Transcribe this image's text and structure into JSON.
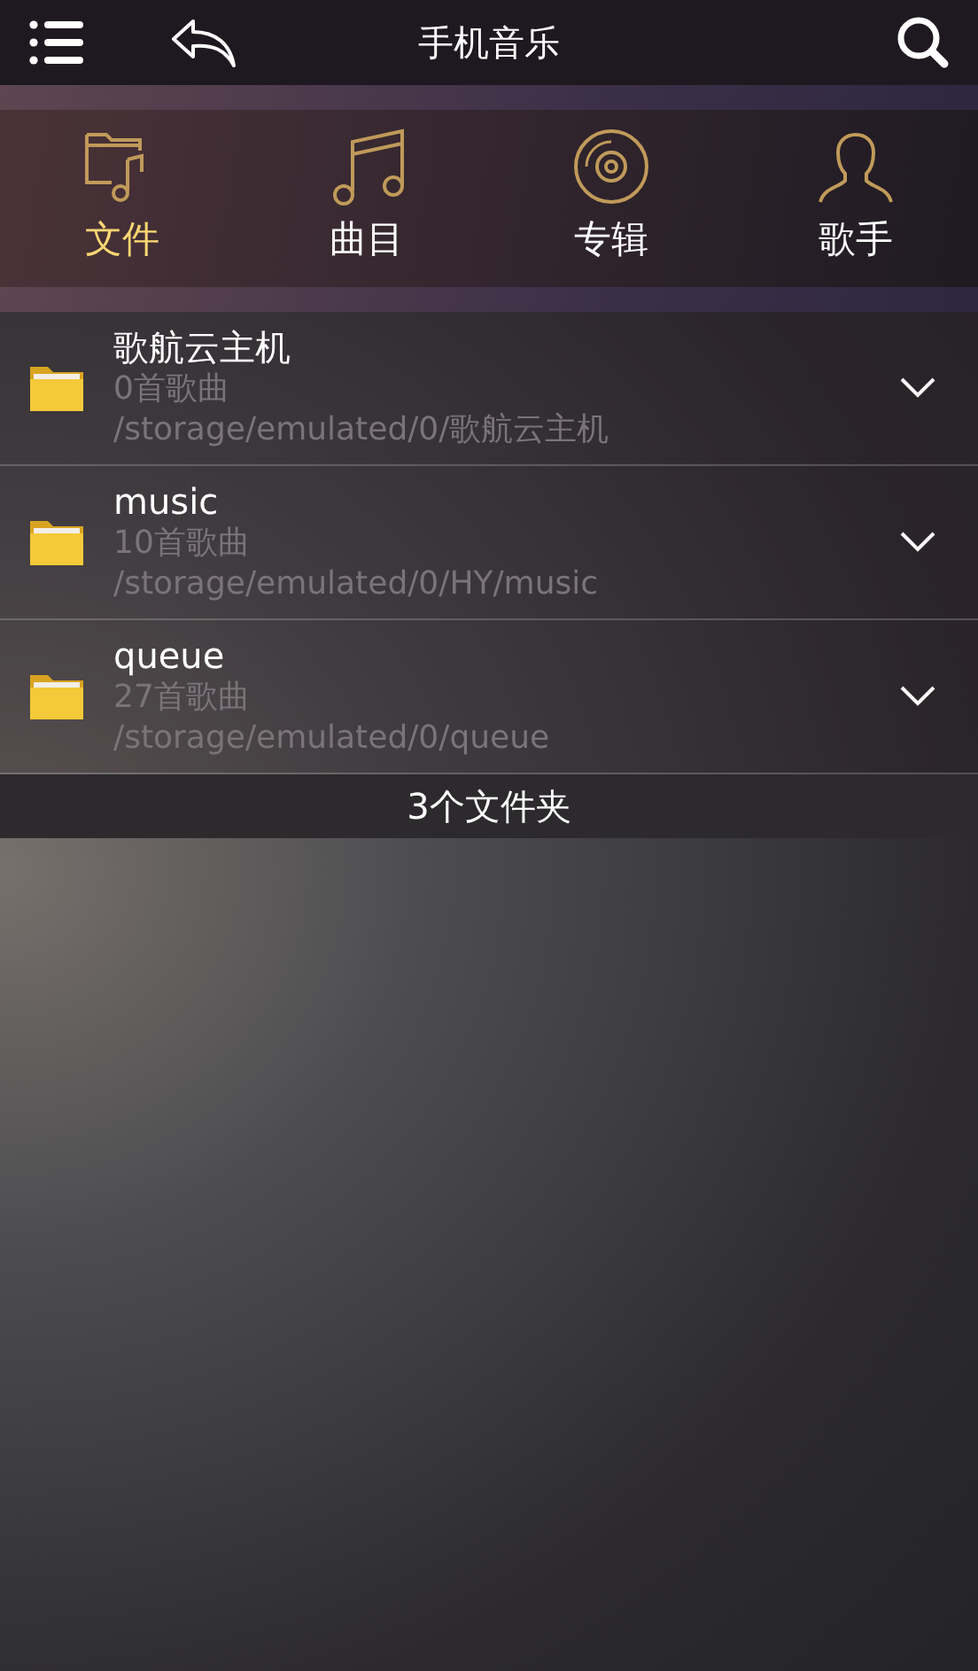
{
  "header": {
    "title": "手机音乐"
  },
  "tabs": [
    {
      "kind": "folder",
      "label": "文件",
      "selected": true
    },
    {
      "kind": "note",
      "label": "曲目",
      "selected": false
    },
    {
      "kind": "disc",
      "label": "专辑",
      "selected": false
    },
    {
      "kind": "person",
      "label": "歌手",
      "selected": false
    }
  ],
  "folders": [
    {
      "name": "歌航云主机",
      "count": "0首歌曲",
      "path": "/storage/emulated/0/歌航云主机"
    },
    {
      "name": "music",
      "count": "10首歌曲",
      "path": "/storage/emulated/0/HY/music"
    },
    {
      "name": "queue",
      "count": "27首歌曲",
      "path": "/storage/emulated/0/queue"
    }
  ],
  "footer": "3个文件夹"
}
